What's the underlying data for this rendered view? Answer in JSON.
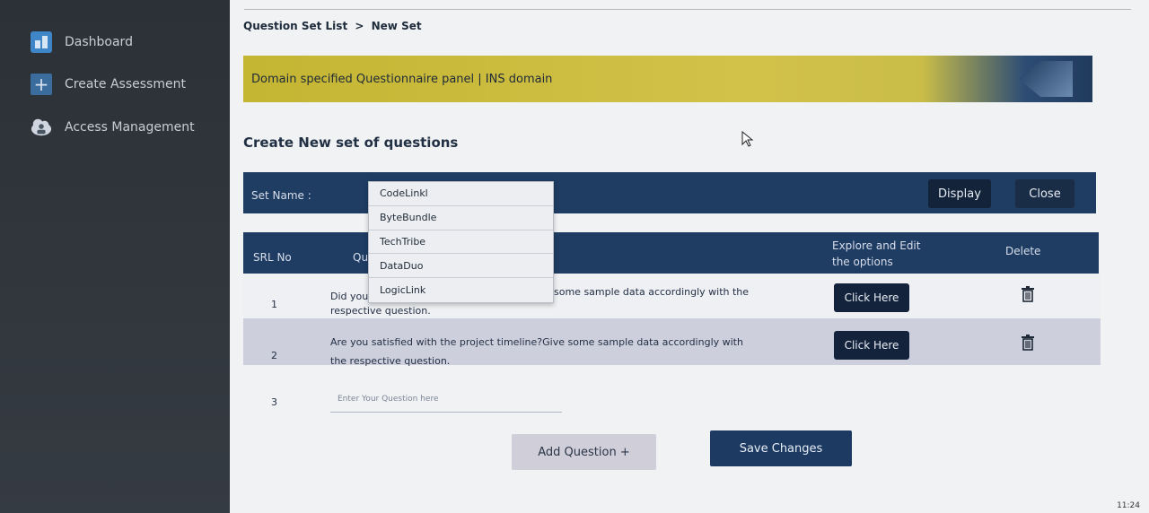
{
  "sidebar": {
    "items": [
      {
        "label": "Dashboard",
        "icon": "dashboard-icon"
      },
      {
        "label": "Create Assessment",
        "icon": "plus-icon"
      },
      {
        "label": "Access Management",
        "icon": "user-cloud-icon"
      }
    ]
  },
  "breadcrumb": {
    "parent": "Question Set List",
    "separator": ">",
    "current": "New Set"
  },
  "banner": {
    "text": "Domain specified Questionnaire panel | INS domain"
  },
  "section_title": "Create New set of questions",
  "setbar": {
    "label": "Set Name :",
    "display_label": "Display",
    "close_label": "Close"
  },
  "dropdown": {
    "options": [
      "CodeLinkl",
      "ByteBundle",
      "TechTribe",
      "DataDuo",
      "LogicLink"
    ]
  },
  "table": {
    "headers": {
      "srl": "SRL No",
      "question": "Qu",
      "explore_line1": "Explore and Edit",
      "explore_line2": "the options",
      "delete": "Delete"
    },
    "rows": [
      {
        "srl": "1",
        "q_line1_start": "Did you",
        "q_line1_end": "some sample data accordingly with the",
        "q_line2": "respective question.",
        "action": "Click Here"
      },
      {
        "srl": "2",
        "q_line1": "Are you satisfied with the project timeline?Give some sample data accordingly with",
        "q_line2": "the respective question.",
        "action": "Click Here"
      },
      {
        "srl": "3",
        "placeholder": "Enter Your Question here"
      }
    ]
  },
  "actions": {
    "add_question": "Add Question +",
    "save_changes": "Save Changes"
  },
  "taskbar": {
    "time": "11:24"
  },
  "colors": {
    "sidebar": "#2c3137",
    "primary": "#1f3c63",
    "banner": "#c4b532",
    "button_dark": "#13233b"
  }
}
